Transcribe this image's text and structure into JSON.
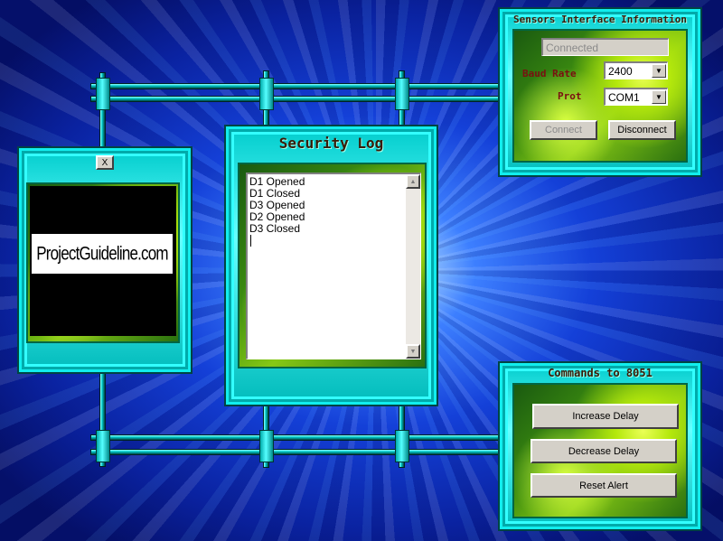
{
  "sensors": {
    "title": "Sensors Interface Information",
    "status_value": "Connected",
    "baud_label": "Baud Rate",
    "baud_value": "2400",
    "port_label": "Prot",
    "port_value": "COM1",
    "connect_label": "Connect",
    "disconnect_label": "Disconnect"
  },
  "video": {
    "close_label": "X",
    "logo_text": "ProjectGuideline.com"
  },
  "log": {
    "title": "Security Log",
    "entries": [
      "D1 Opened",
      "D1 Closed",
      "D3 Opened",
      "D2 Opened",
      "D3 Closed"
    ]
  },
  "commands": {
    "title": "Commands to 8051",
    "increase_label": "Increase Delay",
    "decrease_label": "Decrease Delay",
    "reset_label": "Reset Alert"
  },
  "colors": {
    "panel_teal": "#00cccc",
    "title_brown": "#3a1a06",
    "label_red": "#7a1010"
  }
}
